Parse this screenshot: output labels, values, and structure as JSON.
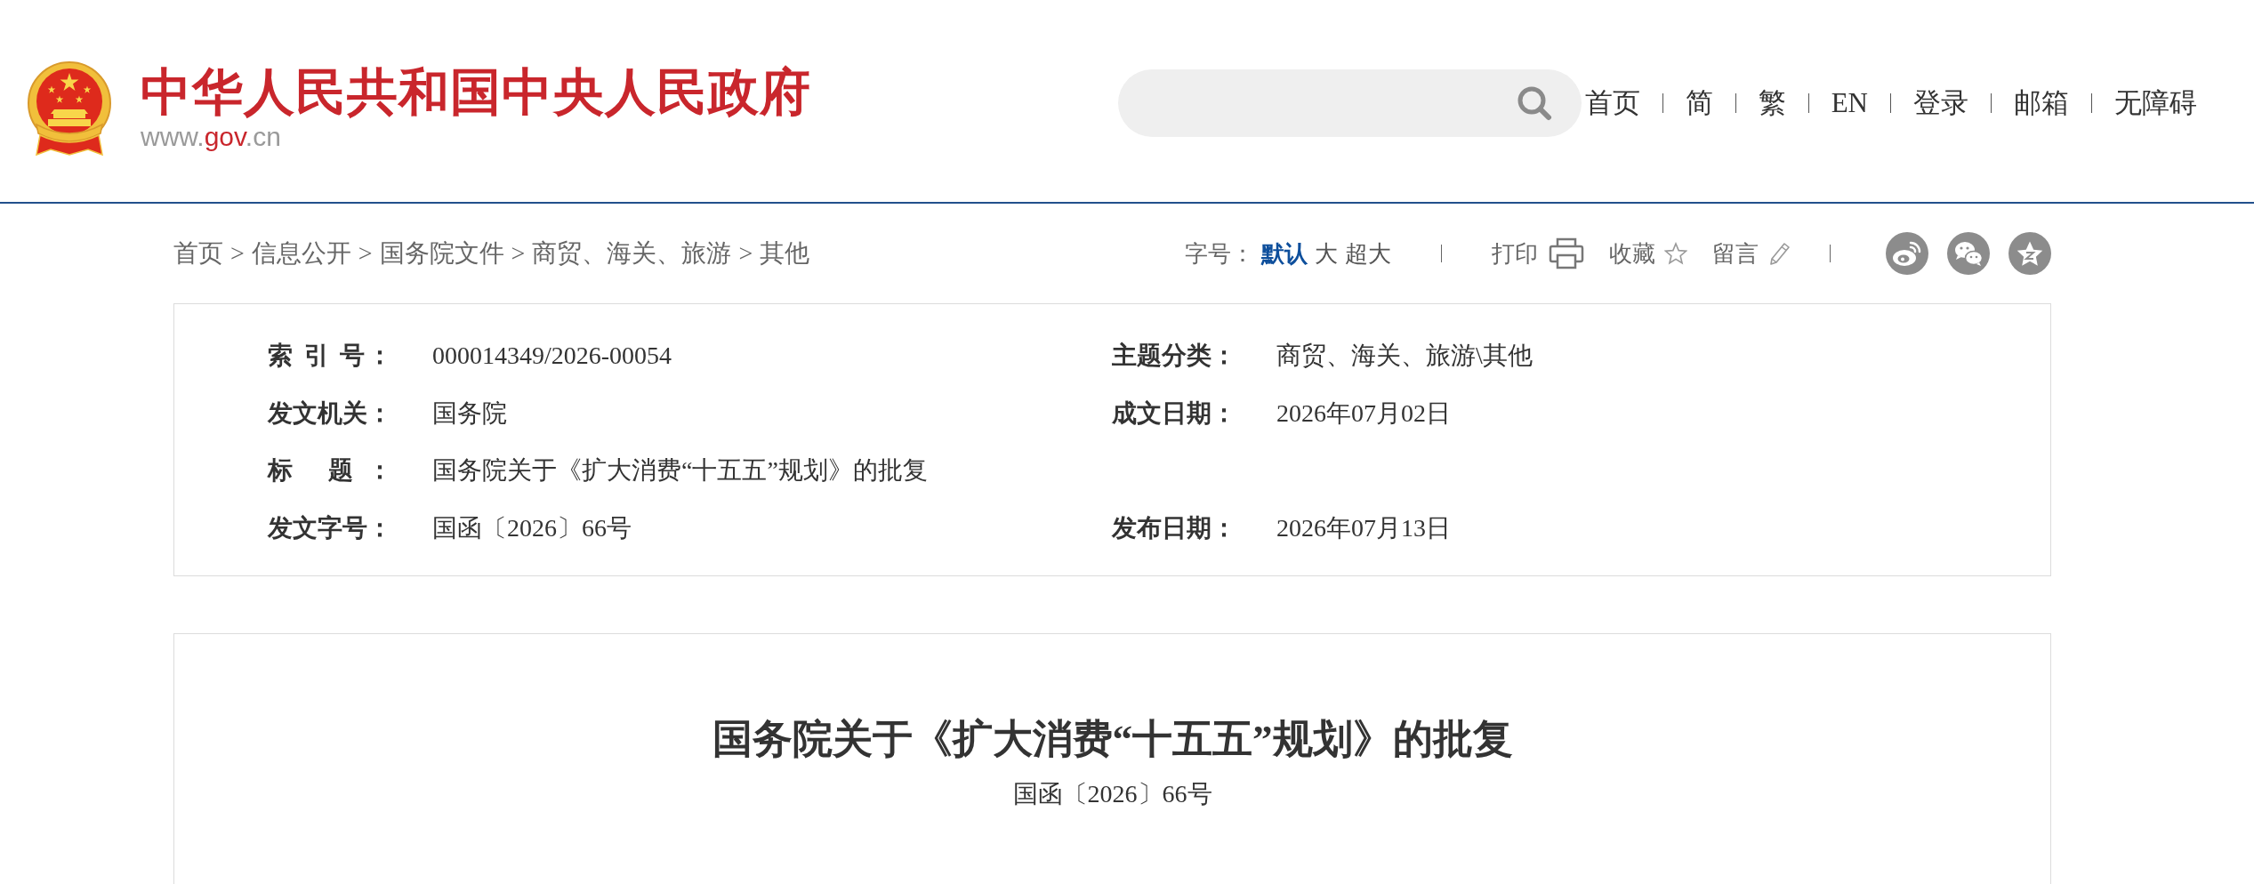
{
  "header": {
    "site_title": "中华人民共和国中央人民政府",
    "site_url": {
      "prefix": "www.",
      "highlight": "gov",
      "suffix": ".cn"
    },
    "nav": [
      "首页",
      "简",
      "繁",
      "EN",
      "登录",
      "邮箱",
      "无障碍"
    ]
  },
  "toolbar": {
    "breadcrumb": [
      {
        "kind": "link",
        "text": "首页"
      },
      {
        "kind": "separator",
        "text": ">"
      },
      {
        "kind": "link",
        "text": "信息公开"
      },
      {
        "kind": "separator",
        "text": ">"
      },
      {
        "kind": "link",
        "text": "国务院文件"
      },
      {
        "kind": "separator",
        "text": ">"
      },
      {
        "kind": "link",
        "text": "商贸、海关、旅游"
      },
      {
        "kind": "separator",
        "text": ">"
      },
      {
        "kind": "link",
        "text": "其他"
      }
    ],
    "font_size": {
      "label": "字号：",
      "options": [
        {
          "label": "默认",
          "selected": true
        },
        {
          "label": "大",
          "selected": false
        },
        {
          "label": "超大",
          "selected": false
        }
      ]
    },
    "actions": [
      {
        "kind": "print",
        "label": "打印"
      },
      {
        "kind": "favorite",
        "label": "收藏"
      },
      {
        "kind": "comment",
        "label": "留言"
      }
    ],
    "share": [
      {
        "kind": "weibo"
      },
      {
        "kind": "wechat"
      },
      {
        "kind": "star"
      }
    ]
  },
  "info": {
    "rows": [
      [
        {
          "label": "索 引 号：",
          "value": "000014349/2026-00054"
        },
        {
          "label": "主题分类：",
          "value": "商贸、海关、旅游\\其他"
        }
      ],
      [
        {
          "label": "发文机关：",
          "value": "国务院"
        },
        {
          "label": "成文日期：",
          "value": "2026年07月02日"
        }
      ],
      [
        {
          "label": "标 题：",
          "value": "国务院关于《扩大消费“十五五”规划》的批复"
        }
      ],
      [
        {
          "label": "发文字号：",
          "value": "国函〔2026〕66号"
        },
        {
          "label": "发布日期：",
          "value": "2026年07月13日"
        }
      ]
    ]
  },
  "article": {
    "title": "国务院关于《扩大消费“十五五”规划》的批复",
    "doc_number": "国函〔2026〕66号"
  }
}
